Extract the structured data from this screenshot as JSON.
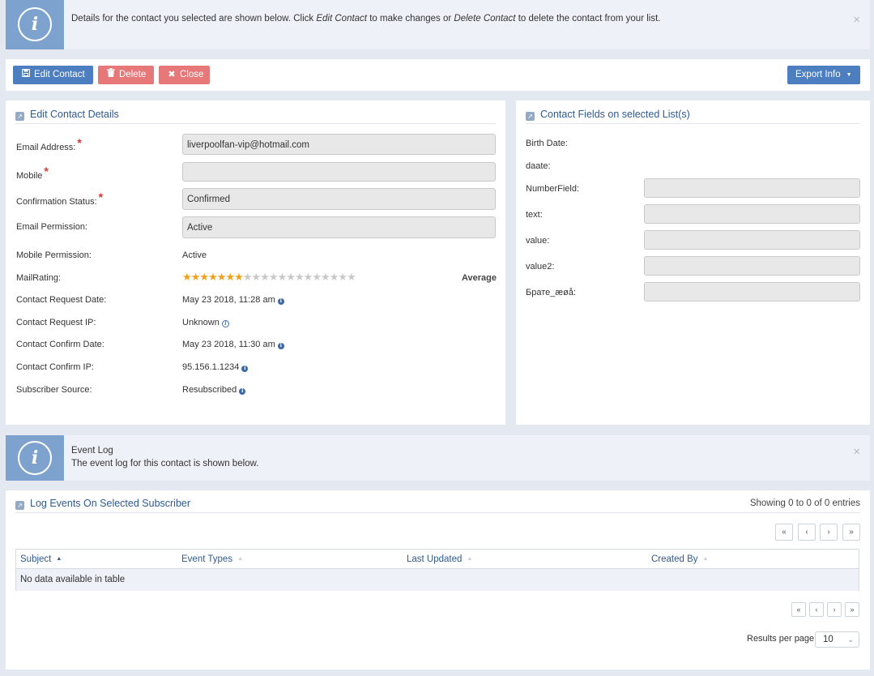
{
  "top_alert": {
    "msg_pre": "Details for the contact you selected are shown below. Click ",
    "msg_edit": "Edit Contact",
    "msg_mid": " to make changes or ",
    "msg_delete": "Delete Contact",
    "msg_post": " to delete the contact from your list.",
    "close": "×"
  },
  "toolbar": {
    "edit_label": "Edit Contact",
    "delete_label": "Delete",
    "close_label": "Close",
    "export_label": "Export Info"
  },
  "details": {
    "title": "Edit Contact Details",
    "email_label": "Email Address:",
    "email_value": "liverpoolfan-vip@hotmail.com",
    "mobile_label": "Mobile",
    "mobile_value": "",
    "confirm_status_label": "Confirmation Status:",
    "confirm_status_value": "Confirmed",
    "email_perm_label": "Email Permission:",
    "email_perm_value": "Active",
    "mobile_perm_label": "Mobile Permission:",
    "mobile_perm_value": "Active",
    "rating_label": "MailRating:",
    "rating_filled": 7,
    "rating_total": 20,
    "rating_text": "Average",
    "req_date_label": "Contact Request Date:",
    "req_date_value": "May 23 2018, 11:28 am",
    "req_ip_label": "Contact Request IP:",
    "req_ip_value": "Unknown",
    "confirm_date_label": "Contact Confirm Date:",
    "confirm_date_value": "May 23 2018, 11:30 am",
    "confirm_ip_label": "Contact Confirm IP:",
    "confirm_ip_value": "95.156.1.1234",
    "source_label": "Subscriber Source:",
    "source_value": "Resubscribed"
  },
  "fields": {
    "title": "Contact Fields on selected List(s)",
    "birth_label": "Birth Date:",
    "daate_label": "daate:",
    "number_label": "NumberField:",
    "text_label": "text:",
    "value_label": "value:",
    "value2_label": "value2:",
    "cyr_label": "Брате_æøå:"
  },
  "event_alert": {
    "title": "Event Log",
    "msg": "The event log for this contact is shown below.",
    "close": "×"
  },
  "log": {
    "title": "Log Events On Selected Subscriber",
    "showing": "Showing 0 to 0 of 0 entries",
    "columns": [
      "Subject",
      "Event Types",
      "Last Updated",
      "Created By"
    ],
    "empty": "No data available in table",
    "per_page_label": "Results per page",
    "per_page_value": "10"
  },
  "colors": {
    "accent": "#4d7ec0",
    "danger": "#e7787a",
    "info": "#7da2cd",
    "star": "#f0a11b"
  }
}
